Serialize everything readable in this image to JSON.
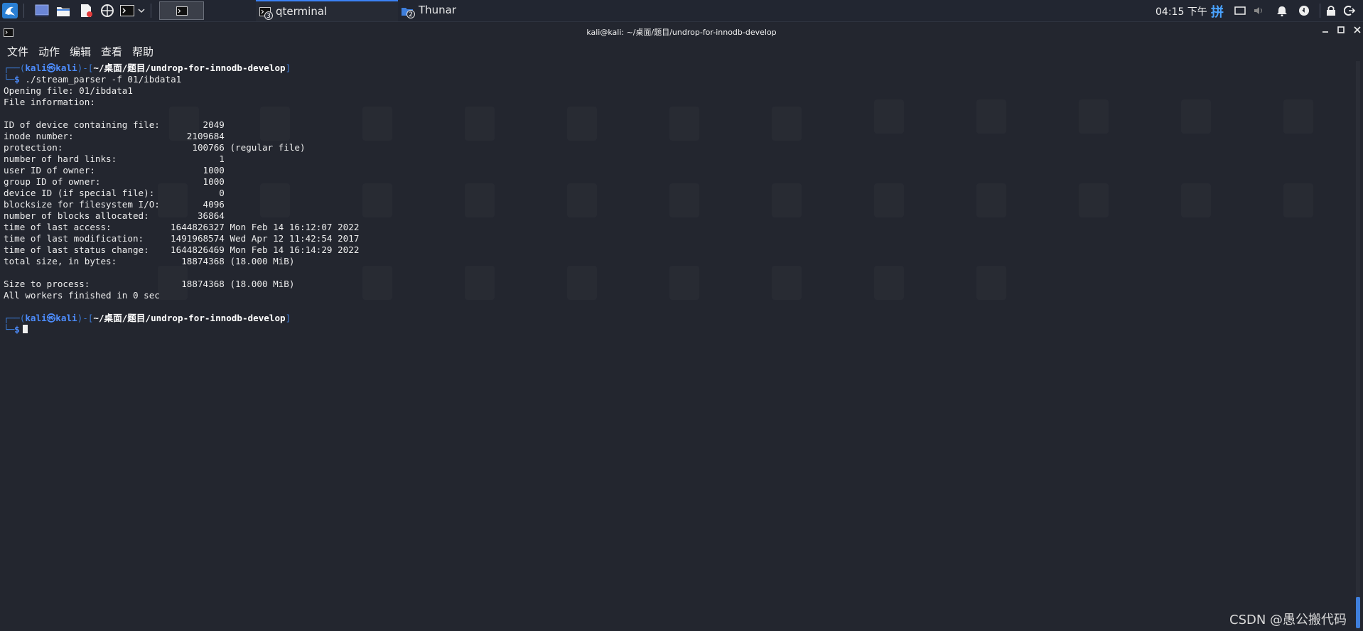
{
  "panel": {
    "tasks": [
      {
        "label": "qterminal",
        "badge": "3"
      },
      {
        "label": "Thunar",
        "badge": "2"
      }
    ],
    "clock": "04:15 下午",
    "ime": "拼"
  },
  "window": {
    "title": "kali@kali: ~/桌面/题目/undrop-for-innodb-develop",
    "menu": [
      "文件",
      "动作",
      "编辑",
      "查看",
      "帮助"
    ]
  },
  "terminal": {
    "prompt1": {
      "user": "kali",
      "host": "kali",
      "path": "~/桌面/题目/undrop-for-innodb-develop",
      "command": "./stream_parser -f 01/ibdata1"
    },
    "output": [
      "Opening file: 01/ibdata1",
      "File information:",
      "",
      "ID of device containing file:        2049",
      "inode number:                     2109684",
      "protection:                        100766 (regular file)",
      "number of hard links:                   1",
      "user ID of owner:                    1000",
      "group ID of owner:                   1000",
      "device ID (if special file):            0",
      "blocksize for filesystem I/O:        4096",
      "number of blocks allocated:         36864",
      "time of last access:           1644826327 Mon Feb 14 16:12:07 2022",
      "time of last modification:     1491968574 Wed Apr 12 11:42:54 2017",
      "time of last status change:    1644826469 Mon Feb 14 16:14:29 2022",
      "total size, in bytes:            18874368 (18.000 MiB)",
      "",
      "Size to process:                 18874368 (18.000 MiB)",
      "All workers finished in 0 sec",
      ""
    ],
    "prompt2": {
      "user": "kali",
      "host": "kali",
      "path": "~/桌面/题目/undrop-for-innodb-develop"
    }
  },
  "watermark": "CSDN @愚公搬代码",
  "icons": {
    "app_menu": "kali-dragon-icon",
    "show_desktop": "desktop-icon",
    "files": "folder-icon",
    "editor": "text-editor-icon",
    "browser": "browser-icon",
    "terminal": "terminal-icon",
    "tray": [
      "screen-icon",
      "volume-icon",
      "bell-icon",
      "power-icon",
      "lock-icon",
      "logout-icon"
    ]
  }
}
